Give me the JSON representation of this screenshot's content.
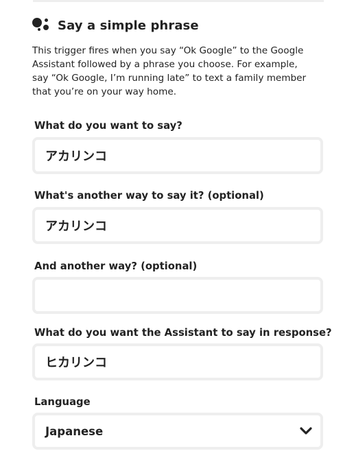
{
  "trigger": {
    "icon": "google-assistant-icon",
    "title": "Say a simple phrase",
    "description": "This trigger fires when you say “Ok Google” to the Google Assistant followed by a phrase you choose. For example, say “Ok Google, I’m running late” to text a family member that you’re on your way home."
  },
  "fields": {
    "phrase": {
      "label": "What do you want to say?",
      "value": "アカリンコ"
    },
    "alt_phrase": {
      "label": "What's another way to say it? (optional)",
      "value": "アカリンコ"
    },
    "alt_phrase_2": {
      "label": "And another way? (optional)",
      "value": ""
    },
    "response": {
      "label": "What do you want the Assistant to say in response?",
      "value": "ヒカリンコ"
    },
    "language": {
      "label": "Language",
      "value": "Japanese",
      "icon": "chevron-down-icon"
    }
  }
}
